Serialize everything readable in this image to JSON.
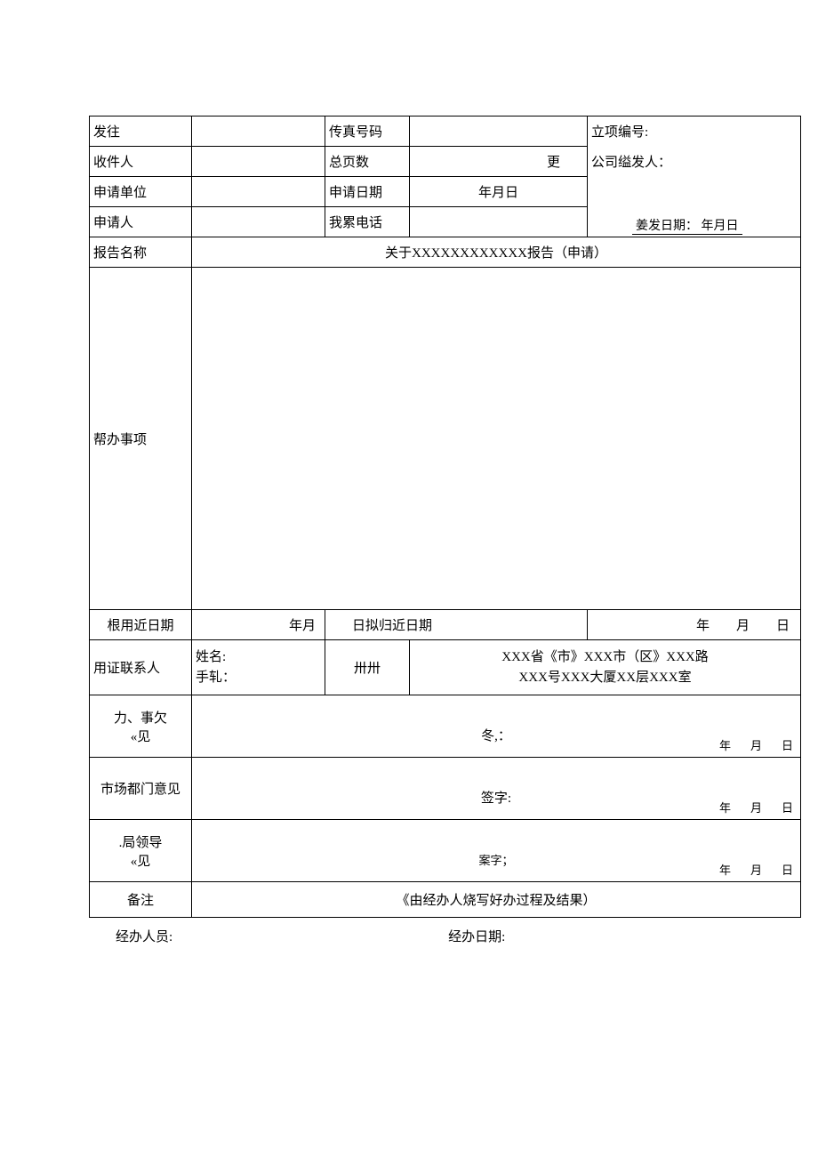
{
  "header": {
    "sendTo": "发往",
    "faxLabel": "传真号码",
    "projectNoLabel": "立项编号:",
    "recipient": "收件人",
    "totalPagesLabel": "总页数",
    "totalPagesValue": "更",
    "companyIssuerLabel": "公司缢发人：",
    "applyUnit": "申请单位",
    "applyDateLabel": "申请日期",
    "applyDateValue": "年月日",
    "applicant": "申请人",
    "contactPhone": "我累电话",
    "issueDate": "姜发日期：        年月日"
  },
  "report": {
    "nameLabel": "报告名称",
    "nameValue": "关于XXXXXXXXXXXX报告（申请）"
  },
  "matters": {
    "label": "帮办事项"
  },
  "loan": {
    "borrowDateLabel": "根用近日期",
    "ym": "年月",
    "returnDateLabel": "日拟归近日期",
    "y": "年",
    "m": "月",
    "d": "日"
  },
  "contact": {
    "label": "用证联系人",
    "nameLabel": "姓名:",
    "handLabel": "手轧：",
    "middle": "卅卅",
    "addrLine1": "XXX省《市》XXX市（区》XXX路",
    "addrLine2": "XXX号XXX大厦XX层XXX室"
  },
  "opinions": {
    "row1Label1": "力、事欠",
    "row1Label2": "«见",
    "row1Sig": "冬,：",
    "row2Label": "市场都门意见",
    "row2Sig": "签字:",
    "row3Label1": ".局领导",
    "row3Label2": "«见",
    "row3Sig": "案字；",
    "y": "年",
    "m": "月",
    "d": "日"
  },
  "remark": {
    "label": "备注",
    "value": "《由经办人烧写好办过程及结果）"
  },
  "footer": {
    "handler": "经办人员:",
    "handleDate": "经办日期:"
  }
}
